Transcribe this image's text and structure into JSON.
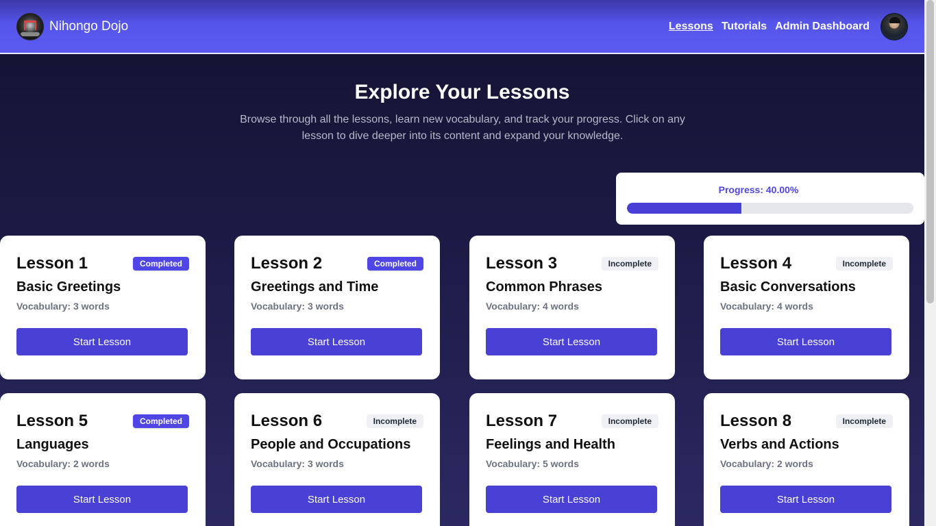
{
  "navbar": {
    "brand": "Nihongo Dojo",
    "links": [
      "Lessons",
      "Tutorials",
      "Admin Dashboard"
    ]
  },
  "hero": {
    "title": "Explore Your Lessons",
    "subtitle": "Browse through all the lessons, learn new vocabulary, and track your progress. Click on any lesson to dive deeper into its content and expand your knowledge."
  },
  "progress": {
    "label": "Progress: 40.00%",
    "percent": 40
  },
  "lessons": [
    {
      "number": "Lesson 1",
      "status": "Completed",
      "title": "Basic Greetings",
      "vocab": "Vocabulary: 3 words",
      "button": "Start Lesson"
    },
    {
      "number": "Lesson 2",
      "status": "Completed",
      "title": "Greetings and Time",
      "vocab": "Vocabulary: 3 words",
      "button": "Start Lesson"
    },
    {
      "number": "Lesson 3",
      "status": "Incomplete",
      "title": "Common Phrases",
      "vocab": "Vocabulary: 4 words",
      "button": "Start Lesson"
    },
    {
      "number": "Lesson 4",
      "status": "Incomplete",
      "title": "Basic Conversations",
      "vocab": "Vocabulary: 4 words",
      "button": "Start Lesson"
    },
    {
      "number": "Lesson 5",
      "status": "Completed",
      "title": "Languages",
      "vocab": "Vocabulary: 2 words",
      "button": "Start Lesson"
    },
    {
      "number": "Lesson 6",
      "status": "Incomplete",
      "title": "People and Occupations",
      "vocab": "Vocabulary: 3 words",
      "button": "Start Lesson"
    },
    {
      "number": "Lesson 7",
      "status": "Incomplete",
      "title": "Feelings and Health",
      "vocab": "Vocabulary: 5 words",
      "button": "Start Lesson"
    },
    {
      "number": "Lesson 8",
      "status": "Incomplete",
      "title": "Verbs and Actions",
      "vocab": "Vocabulary: 2 words",
      "button": "Start Lesson"
    }
  ],
  "colors": {
    "accent": "#4f46e5",
    "navbar": "#5b5bf2",
    "background": "#1c1a45"
  }
}
